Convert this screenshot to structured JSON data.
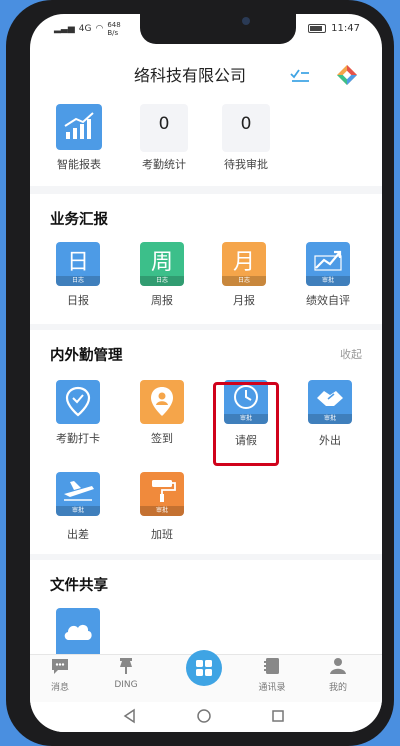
{
  "status": {
    "network": "4G",
    "speed_up": "648",
    "speed_unit": "B/s",
    "battery": "60",
    "time": "11:47"
  },
  "header": {
    "company": "络科技有限公司"
  },
  "quick": {
    "report_label": "智能报表",
    "attendance_count": "0",
    "attendance_label": "考勤统计",
    "approval_count": "0",
    "approval_label": "待我审批"
  },
  "business": {
    "title": "业务汇报",
    "items": [
      {
        "glyph": "日",
        "tag": "日志",
        "label": "日报",
        "color": "#4d9be6"
      },
      {
        "glyph": "周",
        "tag": "日志",
        "label": "周报",
        "color": "#3cbf8a"
      },
      {
        "glyph": "月",
        "tag": "日志",
        "label": "月报",
        "color": "#f5a54a"
      },
      {
        "glyph": "",
        "tag": "审批",
        "label": "绩效自评",
        "color": "#4d9be6"
      }
    ]
  },
  "attendance": {
    "title": "内外勤管理",
    "collapse": "收起",
    "items": [
      {
        "tag": "",
        "label": "考勤打卡",
        "color": "#4d9be6"
      },
      {
        "tag": "",
        "label": "签到",
        "color": "#f5a54a"
      },
      {
        "tag": "审批",
        "label": "请假",
        "color": "#4d9be6"
      },
      {
        "tag": "审批",
        "label": "外出",
        "color": "#4d9be6"
      },
      {
        "tag": "审批",
        "label": "出差",
        "color": "#4d9be6"
      },
      {
        "tag": "审批",
        "label": "加班",
        "color": "#f08a3c"
      }
    ]
  },
  "files": {
    "title": "文件共享"
  },
  "tabs": [
    {
      "label": "消息",
      "icon": "message-icon"
    },
    {
      "label": "DING",
      "icon": "pin-icon"
    },
    {
      "label": "",
      "icon": "grid-icon"
    },
    {
      "label": "通讯录",
      "icon": "contacts-icon"
    },
    {
      "label": "我的",
      "icon": "person-icon"
    }
  ],
  "colors": {
    "accent": "#3fa4e4",
    "highlight": "#d0021b",
    "blue_tile": "#4d9be6",
    "orange_tile": "#f5a54a",
    "green_tile": "#3cbf8a"
  }
}
